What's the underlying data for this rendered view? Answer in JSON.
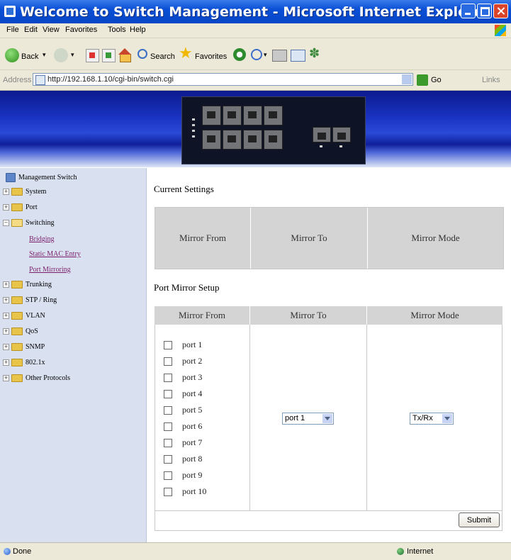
{
  "window": {
    "title": "Welcome to Switch Management - Microsoft Internet Explorer"
  },
  "menubar": [
    "File",
    "Edit",
    "View",
    "Favorites",
    "Tools",
    "Help"
  ],
  "toolbar": {
    "back_label": "Back",
    "search_label": "Search",
    "favorites_label": "Favorites"
  },
  "address_bar": {
    "label": "Address",
    "url": "http://192.168.1.10/cgi-bin/switch.cgi",
    "go_label": "Go",
    "links_label": "Links"
  },
  "sidebar": {
    "root": "Management Switch",
    "items": [
      {
        "label": "System"
      },
      {
        "label": "Port"
      },
      {
        "label": "Switching",
        "children": [
          "Bridging",
          "Static MAC Entry",
          "Port Mirroring"
        ]
      },
      {
        "label": "Trunking"
      },
      {
        "label": "STP / Ring"
      },
      {
        "label": "VLAN"
      },
      {
        "label": "QoS"
      },
      {
        "label": "SNMP"
      },
      {
        "label": "802.1x"
      },
      {
        "label": "Other Protocols"
      }
    ]
  },
  "main": {
    "current_settings_title": "Current Settings",
    "current_headers": [
      "Mirror From",
      "Mirror To",
      "Mirror Mode"
    ],
    "setup_title": "Port Mirror Setup",
    "setup_headers": [
      "Mirror From",
      "Mirror To",
      "Mirror Mode"
    ],
    "ports": [
      "port 1",
      "port 2",
      "port 3",
      "port 4",
      "port 5",
      "port 6",
      "port 7",
      "port 8",
      "port 9",
      "port 10"
    ],
    "mirror_to_selected": "port 1",
    "mirror_mode_selected": "Tx/Rx",
    "submit_label": "Submit"
  },
  "status": {
    "left": "Done",
    "zone": "Internet"
  }
}
